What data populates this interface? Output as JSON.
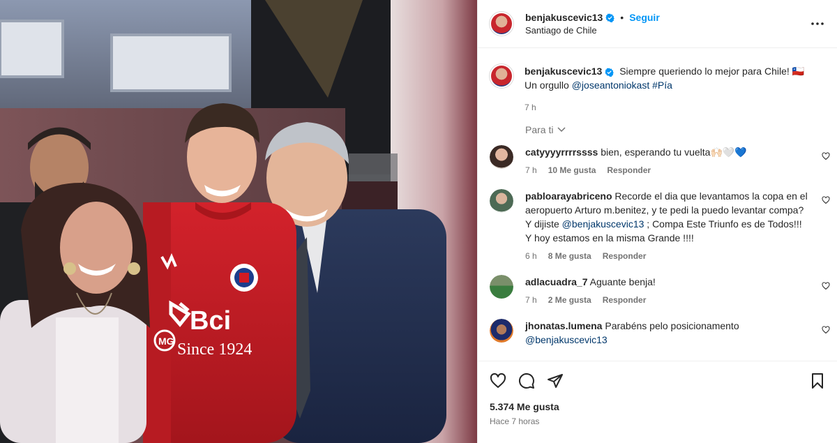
{
  "header": {
    "username": "benjakuscevic13",
    "separator": "•",
    "follow_label": "Seguir",
    "location": "Santiago de Chile",
    "more_icon": "more-horizontal-icon"
  },
  "caption": {
    "username": "benjakuscevic13",
    "text": "Siempre queriendo lo mejor para Chile! 🇨🇱",
    "text2": "Un orgullo",
    "mention": "@joseantoniokast",
    "hashtag": "#Pía",
    "time": "7 h"
  },
  "for_you_label": "Para ti",
  "comments": [
    {
      "username": "catyyyyrrrrssss",
      "text": "bien, esperando tu vuelta🙌🏻🤍💙",
      "time": "7 h",
      "likes": "10 Me gusta",
      "reply": "Responder"
    },
    {
      "username": "pabloarayabriceno",
      "text": "Recorde el dia que levantamos la copa en el aeropuerto Arturo m.benitez, y te pedi la puedo levantar compa? Y dijiste",
      "mention": "@benjakuscevic13",
      "text_after": "; Compa Este Triunfo es de Todos!!! Y hoy estamos en la misma Grande !!!!",
      "time": "6 h",
      "likes": "8 Me gusta",
      "reply": "Responder"
    },
    {
      "username": "adlacuadra_7",
      "text": "Aguante benja!",
      "time": "7 h",
      "likes": "2 Me gusta",
      "reply": "Responder"
    },
    {
      "username": "jhonatas.lumena",
      "text": "Parabéns pelo posicionamento",
      "mention": "@benjakuscevic13"
    }
  ],
  "footer": {
    "likes": "5.374 Me gusta",
    "time": "Hace 7 horas"
  },
  "photo_overlay": {
    "logo_text": "Bci",
    "since_text": "Since 1924",
    "badge_text": "MG"
  },
  "colors": {
    "accent": "#0095f6",
    "mention": "#00376b",
    "muted": "#737373",
    "text": "#262626",
    "jersey": "#d11b23"
  }
}
